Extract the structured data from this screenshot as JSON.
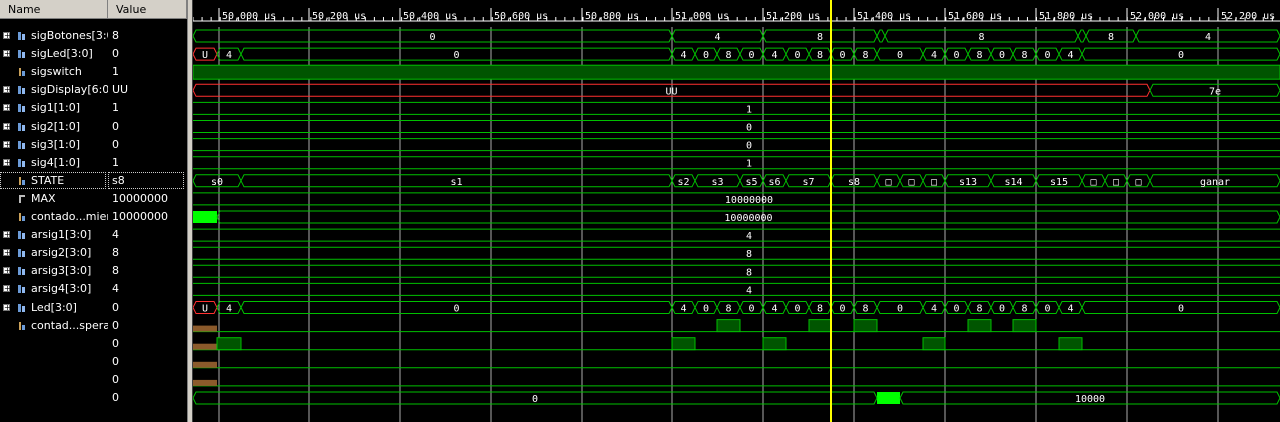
{
  "header": {
    "name_col": "Name",
    "value_col": "Value"
  },
  "ruler": {
    "ticks": [
      "50,000 us",
      "50,200 us",
      "50,400 us",
      "50,600 us",
      "50,800 us",
      "51,000 us",
      "51,200 us",
      "51,400 us",
      "51,600 us",
      "51,800 us",
      "52,000 us",
      "52,200 us"
    ]
  },
  "signals": [
    {
      "name": "sigBotones[3:0]",
      "value": "8",
      "kind": "bus",
      "expandable": true
    },
    {
      "name": "sigLed[3:0]",
      "value": "0",
      "kind": "bus",
      "expandable": true
    },
    {
      "name": "sigswitch",
      "value": "1",
      "kind": "bit",
      "expandable": false
    },
    {
      "name": "sigDisplay[6:0]",
      "value": "UU",
      "kind": "bus",
      "expandable": true
    },
    {
      "name": "sig1[1:0]",
      "value": "1",
      "kind": "bus",
      "expandable": true
    },
    {
      "name": "sig2[1:0]",
      "value": "0",
      "kind": "bus",
      "expandable": true
    },
    {
      "name": "sig3[1:0]",
      "value": "0",
      "kind": "bus",
      "expandable": true
    },
    {
      "name": "sig4[1:0]",
      "value": "1",
      "kind": "bus",
      "expandable": true
    },
    {
      "name": "STATE",
      "value": "s8",
      "kind": "bit",
      "expandable": false,
      "selected": true
    },
    {
      "name": "MAX",
      "value": "10000000",
      "kind": "const",
      "expandable": false
    },
    {
      "name": "contado...mienzo",
      "value": "10000000",
      "kind": "bit",
      "expandable": false
    },
    {
      "name": "arsig1[3:0]",
      "value": "4",
      "kind": "bus",
      "expandable": true
    },
    {
      "name": "arsig2[3:0]",
      "value": "8",
      "kind": "bus",
      "expandable": true
    },
    {
      "name": "arsig3[3:0]",
      "value": "8",
      "kind": "bus",
      "expandable": true
    },
    {
      "name": "arsig4[3:0]",
      "value": "4",
      "kind": "bus",
      "expandable": true
    },
    {
      "name": "Led[3:0]",
      "value": "0",
      "kind": "bus",
      "expandable": true
    },
    {
      "name": "contad...spera5",
      "value": "0",
      "kind": "bit",
      "expandable": false
    },
    {
      "name": "",
      "value": "0",
      "kind": "none",
      "expandable": false
    },
    {
      "name": "",
      "value": "0",
      "kind": "none",
      "expandable": false
    },
    {
      "name": "",
      "value": "0",
      "kind": "none",
      "expandable": false
    },
    {
      "name": "",
      "value": "0",
      "kind": "none",
      "expandable": false
    }
  ],
  "wave_labels": {
    "botones": [
      "0",
      "4",
      "8",
      "8",
      "4"
    ],
    "led": [
      "U",
      "4",
      "0",
      "4",
      "0",
      "8",
      "0",
      "4",
      "0",
      "8",
      "0",
      "8",
      "0",
      "4",
      "0",
      "8",
      "0",
      "8",
      "0",
      "4",
      "0"
    ],
    "display": [
      "UU",
      "7e"
    ],
    "sig1": "1",
    "sig2": "0",
    "sig3": "0",
    "sig4": "1",
    "state": [
      "s0",
      "s1",
      "s2",
      "s3",
      "s5",
      "s6",
      "s7",
      "s8",
      "s13",
      "s14",
      "s15",
      "ganar"
    ],
    "max": "10000000",
    "contador": "10000000",
    "arsig1": "4",
    "arsig2": "8",
    "arsig3": "8",
    "arsig4": "4",
    "ledout": [
      "U",
      "4",
      "0",
      "4",
      "0",
      "8",
      "0",
      "4",
      "0",
      "8",
      "0",
      "8",
      "0",
      "4",
      "0",
      "8",
      "0",
      "8",
      "0",
      "4",
      "0"
    ],
    "last": [
      "0",
      "10000"
    ]
  },
  "colors": {
    "wave": "#00c000",
    "fill": "#005500",
    "bright": "#00ff00",
    "cursor": "#ffff00",
    "grid": "#ffffff",
    "undef": "#ff3030",
    "brown": "#8b5a2b"
  }
}
